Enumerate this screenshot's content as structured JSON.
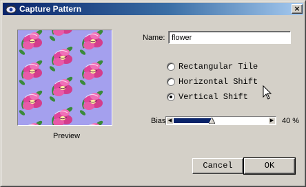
{
  "window": {
    "title": "Capture Pattern",
    "app_icon": "photoshop-eye-icon",
    "close_glyph": "×"
  },
  "preview": {
    "label": "Preview"
  },
  "name_field": {
    "label": "Name:",
    "value": "flower"
  },
  "pattern_type": {
    "options": [
      {
        "label": "Rectangular Tile",
        "selected": false
      },
      {
        "label": "Horizontal Shift",
        "selected": false
      },
      {
        "label": "Vertical Shift",
        "selected": true
      }
    ]
  },
  "bias": {
    "label": "Bias",
    "value_text": "40 %",
    "value_fraction": 0.4
  },
  "buttons": {
    "cancel": "Cancel",
    "ok": "OK"
  },
  "colors": {
    "pattern_background": "#a4a0ee",
    "flower_petal": "#e0449a",
    "flower_center": "#fff2a0",
    "leaf": "#3a8a3a"
  }
}
